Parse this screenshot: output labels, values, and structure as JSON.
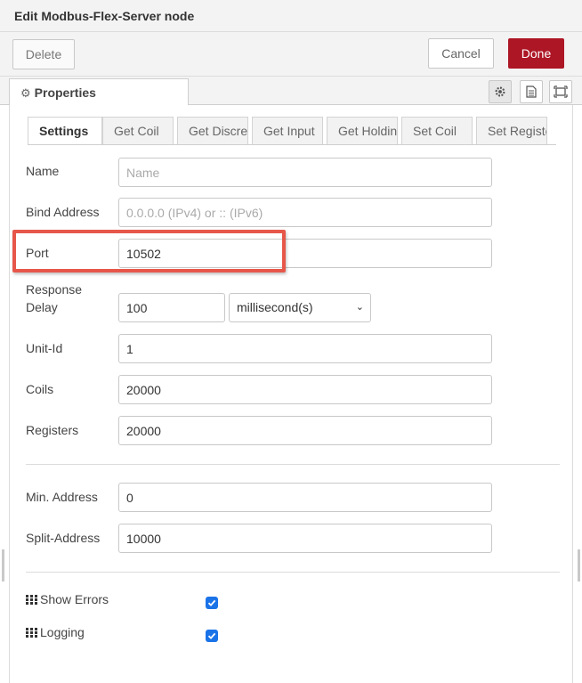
{
  "title": "Edit Modbus-Flex-Server node",
  "buttons": {
    "delete": "Delete",
    "cancel": "Cancel",
    "done": "Done"
  },
  "properties_tab": {
    "label": "Properties",
    "icon": "gear-icon"
  },
  "side_icons": [
    "gear-icon",
    "document-icon",
    "frame-icon"
  ],
  "subtabs": [
    "Settings",
    "Get Coil",
    "Get Discrete",
    "Get Input",
    "Get Holding",
    "Set Coil",
    "Set Register"
  ],
  "fields": {
    "name": {
      "label": "Name",
      "value": "",
      "placeholder": "Name"
    },
    "bind_address": {
      "label": "Bind Address",
      "value": "",
      "placeholder": "0.0.0.0 (IPv4) or :: (IPv6)"
    },
    "port": {
      "label": "Port",
      "value": "10502"
    },
    "response_delay": {
      "label_line1": "Response",
      "label_line2": "Delay",
      "value": "100",
      "unit": "millisecond(s)"
    },
    "unit_id": {
      "label": "Unit-Id",
      "value": "1"
    },
    "coils": {
      "label": "Coils",
      "value": "20000"
    },
    "registers": {
      "label": "Registers",
      "value": "20000"
    },
    "min_address": {
      "label": "Min. Address",
      "value": "0"
    },
    "split_address": {
      "label": "Split-Address",
      "value": "10000"
    }
  },
  "options": {
    "show_errors": {
      "label": "Show Errors",
      "checked": true
    },
    "logging": {
      "label": "Logging",
      "checked": true
    }
  },
  "colors": {
    "done": "#ad1625",
    "highlight": "#e6574a",
    "checkbox": "#1b73e8"
  }
}
